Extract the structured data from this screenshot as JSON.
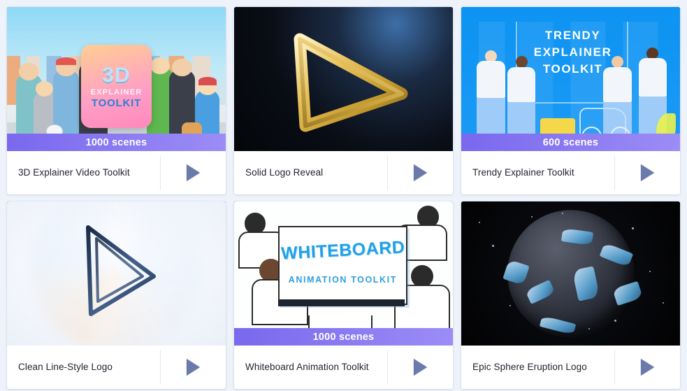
{
  "page": {
    "background_color": "#eef2fa",
    "card_background": "#ffffff",
    "banner_gradient_from": "#7a68ee",
    "banner_gradient_to": "#9c8cf6",
    "play_icon_color": "#6b7aab",
    "title_color": "#20242e"
  },
  "cards": [
    {
      "title": "3D Explainer Video Toolkit",
      "scenes_badge": "1000 scenes",
      "has_badge": true,
      "thumbnail": "3d-explainer-characters-thumbnail",
      "thumbnail_text": {
        "line1": "3D",
        "line2": "EXPLAINER",
        "line3": "TOOLKIT"
      },
      "play_label": "play-preview"
    },
    {
      "title": "Solid Logo Reveal",
      "scenes_badge": "",
      "has_badge": false,
      "thumbnail": "gold-triangle-logo-thumbnail",
      "thumbnail_text": {
        "line1": "",
        "line2": "",
        "line3": ""
      },
      "play_label": "play-preview"
    },
    {
      "title": "Trendy Explainer Toolkit",
      "scenes_badge": "600 scenes",
      "has_badge": true,
      "thumbnail": "trendy-explainer-flat-characters-thumbnail",
      "thumbnail_text": {
        "line1": "TRENDY",
        "line2": "EXPLAINER",
        "line3": "TOOLKIT"
      },
      "play_label": "play-preview"
    },
    {
      "title": "Clean Line-Style Logo",
      "scenes_badge": "",
      "has_badge": false,
      "thumbnail": "line-style-triangle-logo-thumbnail",
      "thumbnail_text": {
        "line1": "",
        "line2": "",
        "line3": ""
      },
      "play_label": "play-preview"
    },
    {
      "title": "Whiteboard Animation Toolkit",
      "scenes_badge": "1000 scenes",
      "has_badge": true,
      "thumbnail": "whiteboard-animation-lineart-thumbnail",
      "thumbnail_text": {
        "line1": "WHITEBOARD",
        "line2": "ANIMATION  TOOLKIT",
        "line3": ""
      },
      "play_label": "play-preview"
    },
    {
      "title": "Epic Sphere Eruption Logo",
      "scenes_badge": "",
      "has_badge": false,
      "thumbnail": "epic-sphere-eruption-thumbnail",
      "thumbnail_text": {
        "line1": "",
        "line2": "",
        "line3": ""
      },
      "play_label": "play-preview"
    }
  ]
}
